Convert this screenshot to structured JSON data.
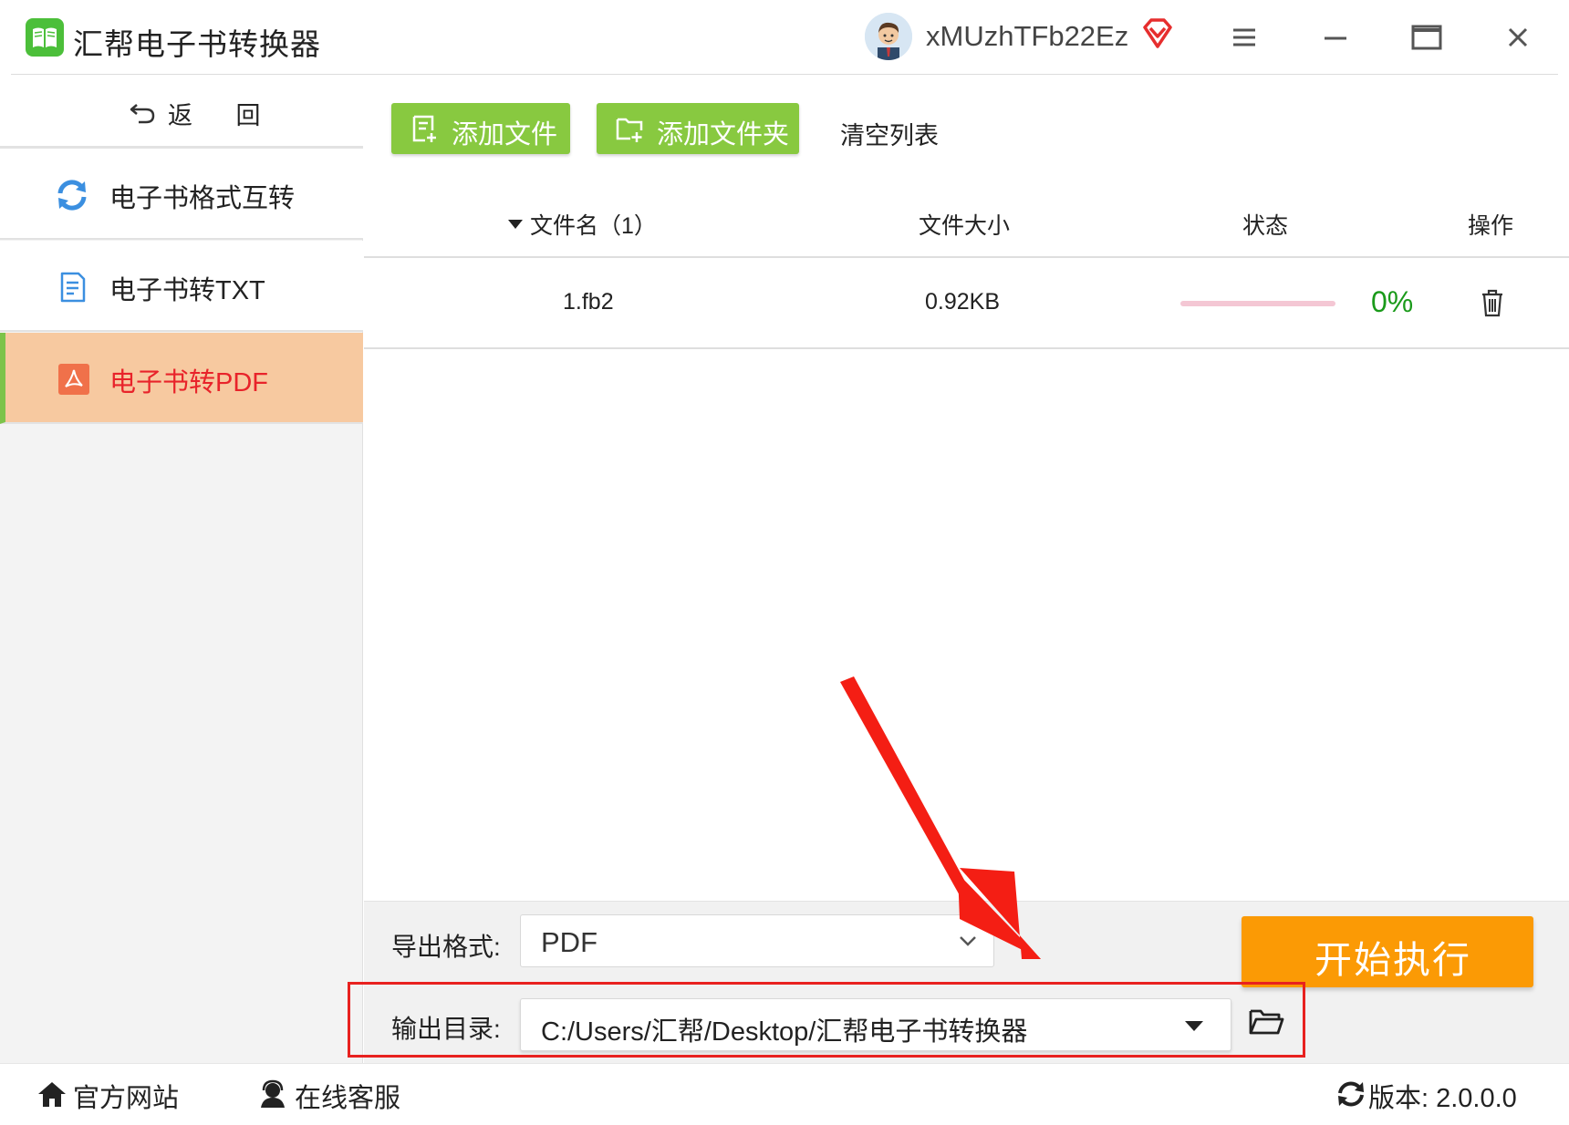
{
  "app": {
    "title": "汇帮电子书转换器",
    "username": "xMUzhTFb22Ez",
    "accent_green": "#88c940",
    "selected_bg": "#f7c9a0",
    "start_orange": "#fb9a05"
  },
  "sidebar": {
    "back_label": "返 回",
    "items": [
      {
        "label": "电子书格式互转",
        "icon": "refresh-icon",
        "selected": false
      },
      {
        "label": "电子书转TXT",
        "icon": "document-icon",
        "selected": false
      },
      {
        "label": "电子书转PDF",
        "icon": "pdf-icon",
        "selected": true
      }
    ]
  },
  "toolbar": {
    "add_file": "添加文件",
    "add_folder": "添加文件夹",
    "clear_list": "清空列表"
  },
  "table": {
    "headers": {
      "name": "文件名（1）",
      "size": "文件大小",
      "status": "状态",
      "action": "操作"
    },
    "rows": [
      {
        "name": "1.fb2",
        "size": "0.92KB",
        "progress": 0,
        "progress_label": "0%"
      }
    ]
  },
  "settings": {
    "format_label": "导出格式:",
    "format_value": "PDF",
    "output_label": "输出目录:",
    "output_path": "C:/Users/汇帮/Desktop/汇帮电子书转换器",
    "start_label": "开始执行"
  },
  "footer": {
    "official_site": "官方网站",
    "online_support": "在线客服",
    "version": "版本: 2.0.0.0"
  }
}
